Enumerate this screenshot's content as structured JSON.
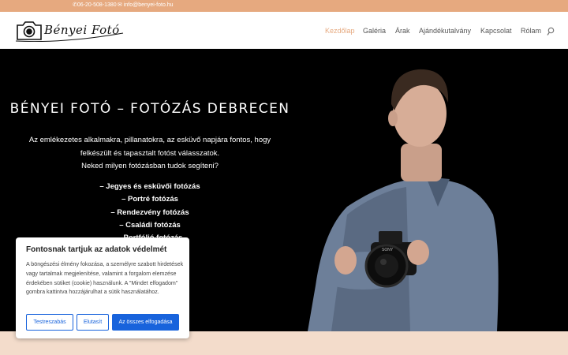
{
  "topbar": {
    "phone": "06-20-508-1380",
    "email": "info@benyei-foto.hu",
    "phone_icon": "phone-icon",
    "email_icon": "envelope-icon"
  },
  "header": {
    "logo_text": "Bényei Fotó",
    "nav": [
      {
        "label": "Kezdőlap"
      },
      {
        "label": "Galéria"
      },
      {
        "label": "Árak"
      },
      {
        "label": "Ajándékutalvány"
      },
      {
        "label": "Kapcsolat"
      },
      {
        "label": "Rólam"
      }
    ],
    "search_icon": "search-icon"
  },
  "hero": {
    "title": "BÉNYEI FOTÓ – FOTÓZÁS DEBRECEN",
    "intro_line1": "Az emlékezetes alkalmakra, pillanatokra, az esküvő napjára fontos, hogy",
    "intro_line2": "felkészült és tapasztalt fotóst válasszatok.",
    "intro_line3": "Neked milyen fotózásban tudok segíteni?",
    "services": [
      "– Jegyes és esküvői fotózás",
      "– Portré fotózás",
      "– Rendezvény fotózás",
      "– Családi fotózás",
      "– Portfólió fotózás"
    ],
    "camera_brand": "SONY"
  },
  "cookie": {
    "title": "Fontosnak tartjuk az adatok védelmét",
    "text": "A böngészési élmény fokozása, a személyre szabott hirdetések vagy tartalmak megjelenítése, valamint a forgalom elemzése érdekében sütiket (cookie) használunk. A \"Mindet elfogadom\" gombra kattintva hozzájárulhat a sütik használatához.",
    "customize": "Testreszabás",
    "reject": "Elutasít",
    "accept": "Az összes elfogadása"
  },
  "colors": {
    "accent": "#e6a97f",
    "cookie_button": "#1863dc",
    "hero_bg": "#000000"
  }
}
